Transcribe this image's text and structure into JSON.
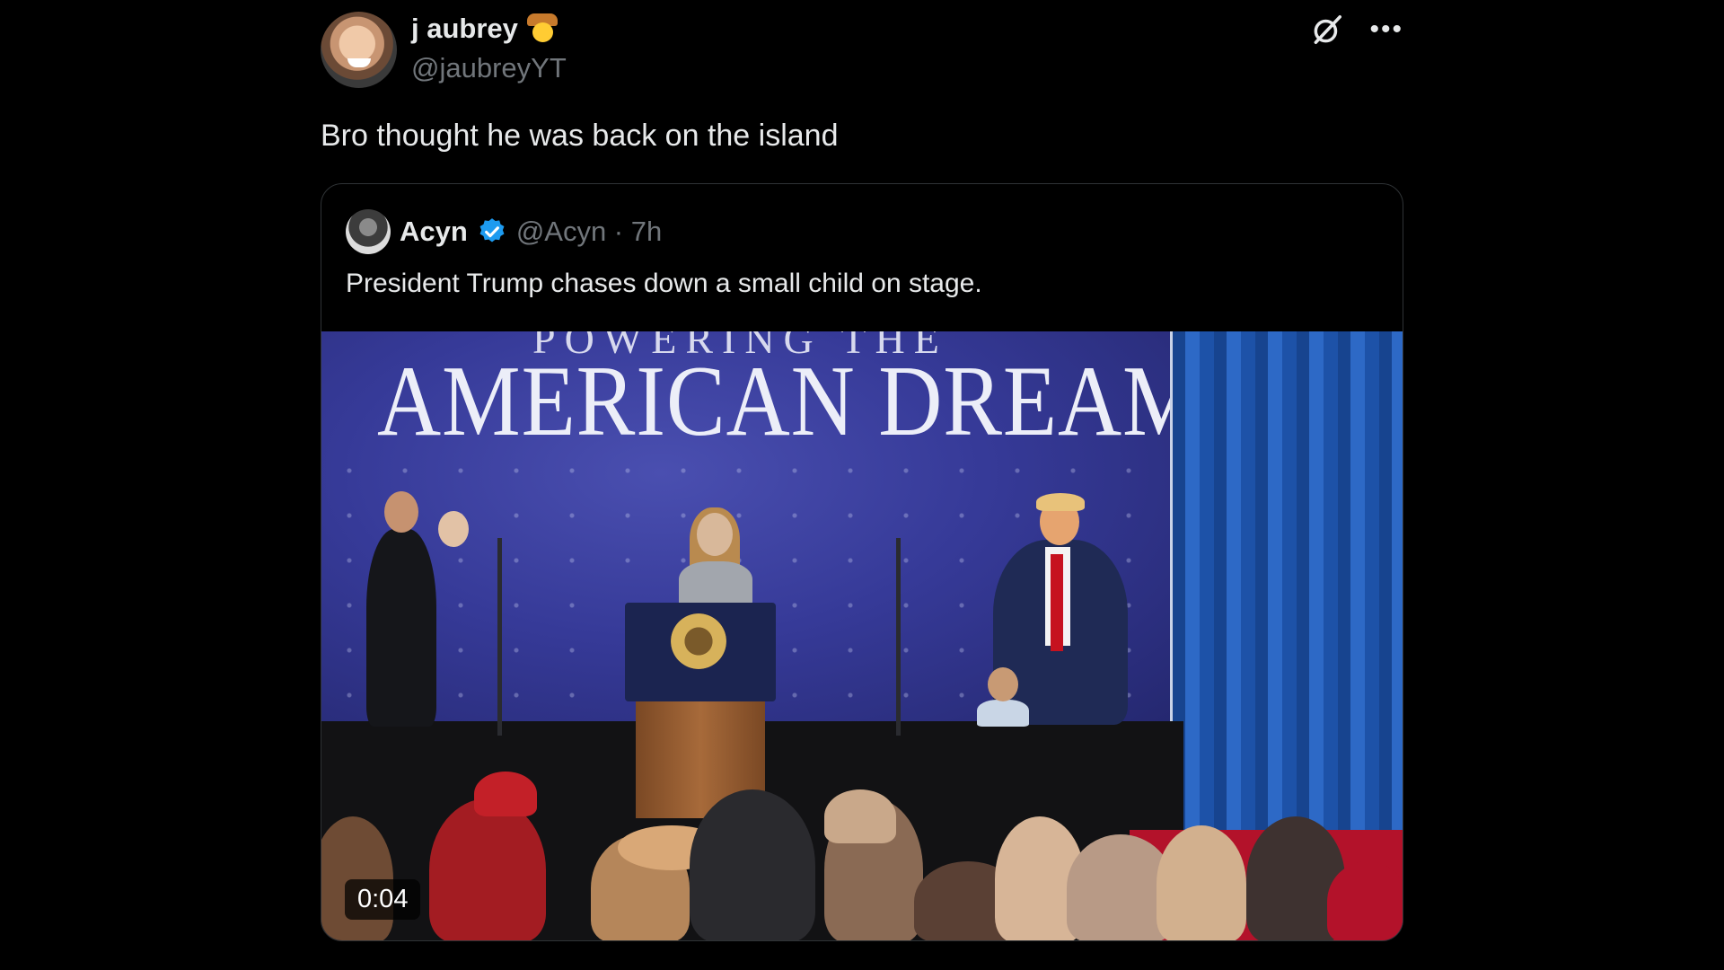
{
  "tweet": {
    "display_name": "j aubrey",
    "name_emoji": "cowboy-face-emoji",
    "handle": "@jaubreyYT",
    "text": "Bro thought he was back on the island",
    "icons": [
      "grok-icon",
      "more-icon"
    ]
  },
  "quoted": {
    "display_name": "Acyn",
    "verified": true,
    "handle_time": "@Acyn · 7h",
    "text": "President Trump chases down a small child on stage.",
    "video": {
      "backdrop_top": "POWERING THE",
      "backdrop_slogan": "AMERICAN DREAM",
      "duration": "0:04"
    }
  },
  "colors": {
    "background": "#000000",
    "text": "#e7e9ea",
    "muted": "#71767b",
    "border": "#2f3336",
    "verified": "#1d9bf0"
  }
}
